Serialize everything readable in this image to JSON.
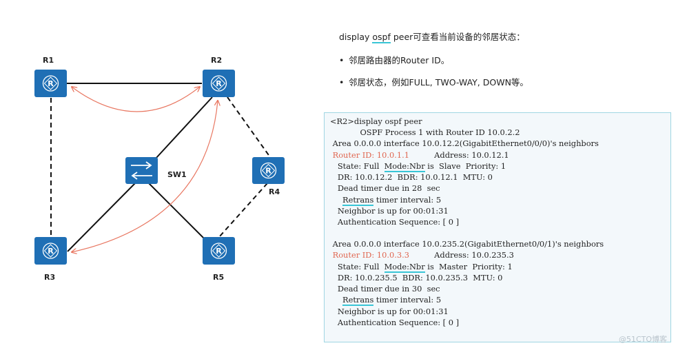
{
  "nodes": {
    "r1": "R1",
    "r2": "R2",
    "r3": "R3",
    "r4": "R4",
    "r5": "R5",
    "sw1": "SW1"
  },
  "intro": {
    "prefix": "display ",
    "ospf": "ospf",
    "suffix": " peer可查看当前设备的邻居状态：",
    "bullet_1": "邻居路由器的Router ID。",
    "bullet_2": "邻居状态，例如FULL, TWO-WAY, DOWN等。"
  },
  "console": {
    "line_01": "<R2>display ospf peer",
    "line_02": "            OSPF Process 1 with Router ID 10.0.2.2",
    "line_03": " Area 0.0.0.0 interface 10.0.12.2(GigabitEthernet0/0/0)'s neighbors",
    "line_04_red": " Router ID: 10.0.1.1",
    "line_04_rest": "          Address: 10.0.12.1",
    "line_05_a": "   State: Full  ",
    "line_05_mode": "Mode:Nbr",
    "line_05_b": " is  Slave  Priority: 1",
    "line_06": "   DR: 10.0.12.2  BDR: 10.0.12.1  MTU: 0",
    "line_07": "   Dead timer due in 28  sec",
    "line_08_retrans": "Retrans",
    "line_08_rest": " timer interval: 5",
    "line_09": "   Neighbor is up for 00:01:31",
    "line_10": "   Authentication Sequence: [ 0 ]",
    "line_11": " Area 0.0.0.0 interface 10.0.235.2(GigabitEthernet0/0/1)'s neighbors",
    "line_12_red": " Router ID: 10.0.3.3",
    "line_12_rest": "          Address: 10.0.235.3",
    "line_13_a": "   State: Full  ",
    "line_13_mode": "Mode:Nbr",
    "line_13_b": " is  Master  Priority: 1",
    "line_14": "   DR: 10.0.235.5  BDR: 10.0.235.3  MTU: 0",
    "line_15": "   Dead timer due in 30  sec",
    "line_16_retrans": "Retrans",
    "line_16_rest": " timer interval: 5",
    "line_17": "   Neighbor is up for 00:01:31",
    "line_18": "   Authentication Sequence: [ 0 ]"
  },
  "watermark": "@51CTO博客",
  "colors": {
    "device": "#1f6fb5",
    "arrow": "#e8755f",
    "highlight": "#e06650",
    "underline": "#38c5d6",
    "panel_bg": "#f3f8fb",
    "panel_border": "#9fd6e2"
  },
  "icons": {
    "router": "router-icon",
    "switch": "switch-icon"
  }
}
